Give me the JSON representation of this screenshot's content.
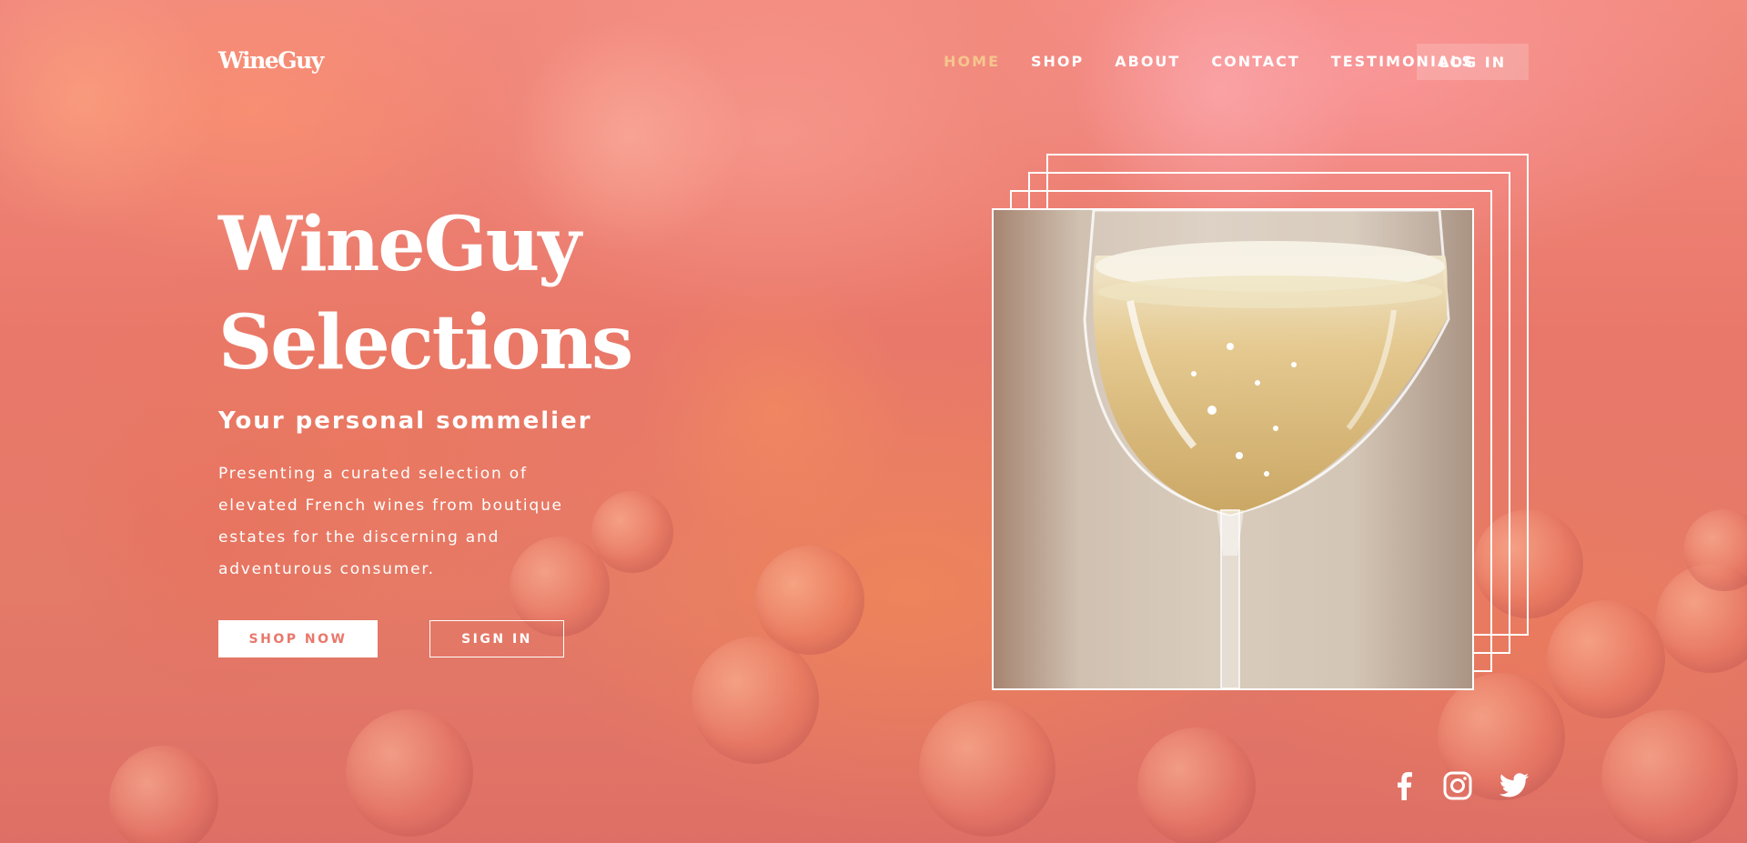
{
  "brand": {
    "logo": "WineGuy"
  },
  "nav": {
    "items": [
      {
        "label": "HOME",
        "active": true
      },
      {
        "label": "SHOP",
        "active": false
      },
      {
        "label": "ABOUT",
        "active": false
      },
      {
        "label": "CONTACT",
        "active": false
      },
      {
        "label": "TESTIMONIALS",
        "active": false
      }
    ],
    "login_label": "LOG IN"
  },
  "hero": {
    "title_line1": "WineGuy",
    "title_line2": "Selections",
    "subtitle": "Your personal sommelier",
    "description": "Presenting a curated selection of elevated French wines from boutique estates for the discerning and adventurous consumer.",
    "shop_button": "SHOP NOW",
    "signin_button": "SIGN IN"
  },
  "social": {
    "icons": [
      "facebook-icon",
      "instagram-icon",
      "twitter-icon"
    ]
  },
  "colors": {
    "accent_active_nav": "#f6c58d",
    "button_text": "#e8786b",
    "background": "#e97a6e"
  }
}
